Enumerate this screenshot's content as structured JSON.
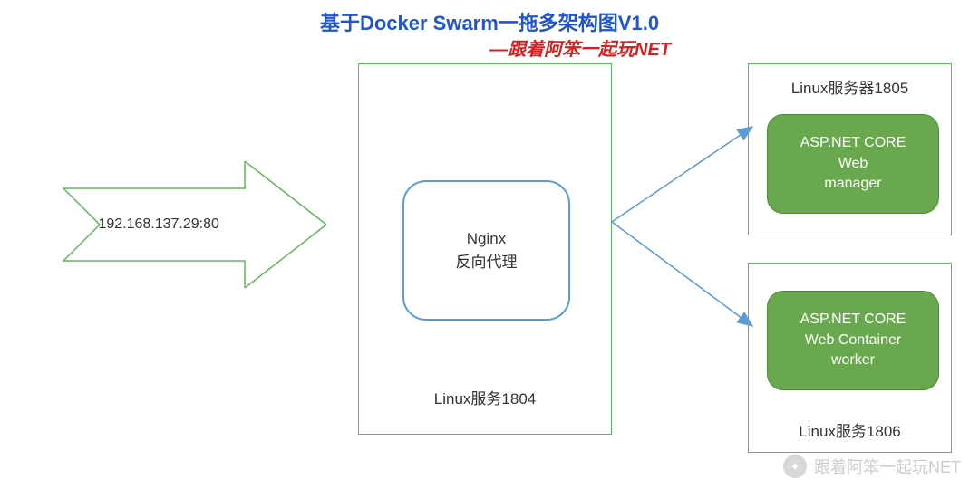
{
  "title": "基于Docker Swarm一拖多架构图V1.0",
  "subtitle": "—跟着阿笨一起玩NET",
  "entry": {
    "ip": "192.168.137.29:80"
  },
  "center": {
    "nginx_line1": "Nginx",
    "nginx_line2": "反向代理",
    "caption": "Linux服务1804"
  },
  "right1": {
    "caption": "Linux服务器1805",
    "app_line1": "ASP.NET CORE",
    "app_line2": "Web",
    "app_line3": "manager"
  },
  "right2": {
    "caption": "Linux服务1806",
    "app_line1": "ASP.NET CORE",
    "app_line2": "Web Container",
    "app_line3": "worker"
  },
  "watermark": "跟着阿笨一起玩NET",
  "colors": {
    "title": "#2155cc",
    "subtitle": "#d42020",
    "boxBorder": "#5fb85f",
    "nginxBorder": "#5a9bd5",
    "pillFill": "#6aa84f"
  }
}
